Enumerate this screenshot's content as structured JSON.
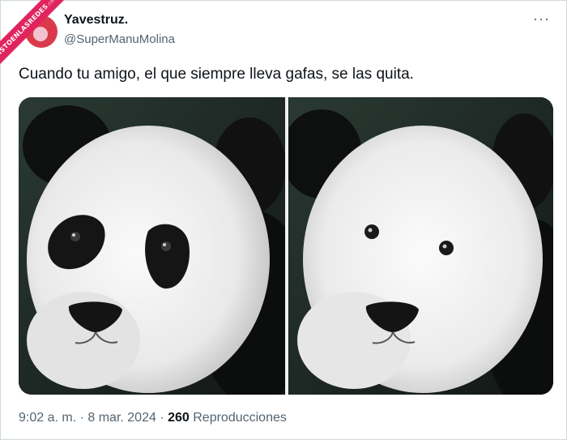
{
  "watermark": {
    "text": "VISTOENLASREDES",
    "sub": ".com"
  },
  "author": {
    "name": "Yavestruz.",
    "handle": "@SuperManuMolina"
  },
  "more_label": "···",
  "tweet": {
    "text": "Cuando tu amigo, el que siempre lleva gafas, se las quita."
  },
  "media": {
    "left_alt": "panda",
    "right_alt": "panda"
  },
  "meta": {
    "time": "9:02 a. m.",
    "sep1": " · ",
    "date": "8 mar. 2024",
    "sep2": " · ",
    "views": "260",
    "views_label": " Reproducciones"
  },
  "colors": {
    "text": "#0f1419",
    "secondary": "#536471",
    "border": "#cfd9de",
    "ribbon": "#e0245e"
  }
}
